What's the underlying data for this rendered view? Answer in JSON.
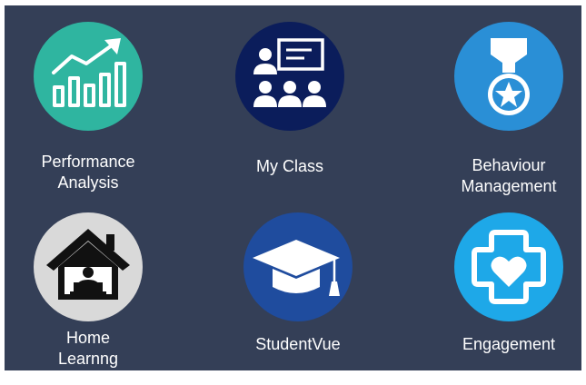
{
  "tiles": [
    {
      "label": "Performance\nAnalysis",
      "icon": "chart-growth-icon",
      "color": "#2fb5a0"
    },
    {
      "label": "My Class",
      "icon": "classroom-icon",
      "color": "#0b1d5b"
    },
    {
      "label": "Behaviour\nManagement",
      "icon": "medal-icon",
      "color": "#2a8fd6"
    },
    {
      "label": "Home\nLearnng",
      "icon": "home-laptop-icon",
      "color": "#d9d9d9"
    },
    {
      "label": "StudentVue",
      "icon": "graduation-cap-icon",
      "color": "#1f4c9e"
    },
    {
      "label": "Engagement",
      "icon": "heart-cross-icon",
      "color": "#1ea8e8"
    }
  ]
}
